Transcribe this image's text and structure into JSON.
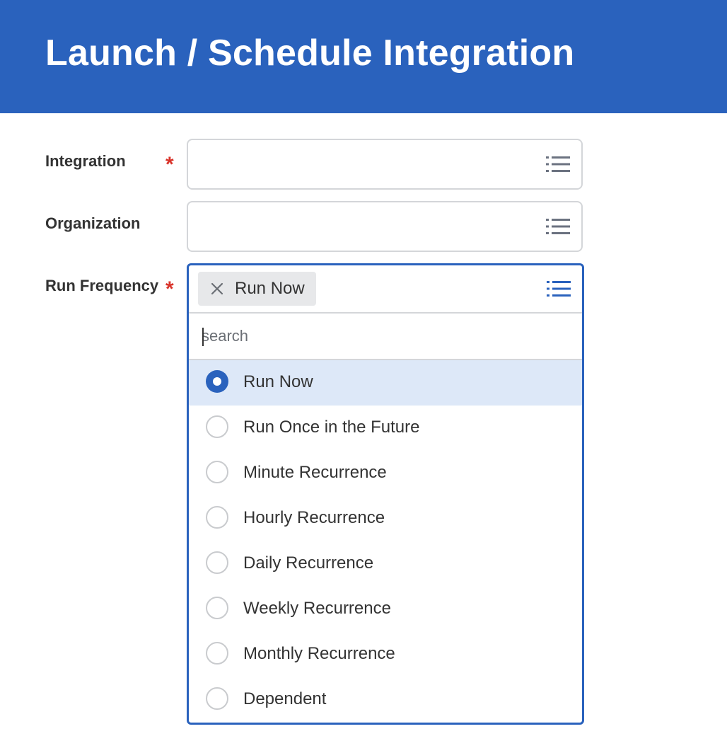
{
  "header": {
    "title": "Launch / Schedule Integration",
    "background_color": "#2a62bd"
  },
  "form": {
    "integration": {
      "label": "Integration",
      "required_marker": "*",
      "value": "",
      "icon": "list-icon"
    },
    "organization": {
      "label": "Organization",
      "value": "",
      "icon": "list-icon"
    },
    "run_frequency": {
      "label": "Run Frequency",
      "required_marker": "*",
      "selected_pill": "Run Now",
      "remove_icon": "close-icon",
      "icon": "list-icon",
      "search_placeholder": "search",
      "options": [
        {
          "label": "Run Now",
          "selected": true
        },
        {
          "label": "Run Once in the Future",
          "selected": false
        },
        {
          "label": "Minute Recurrence",
          "selected": false
        },
        {
          "label": "Hourly Recurrence",
          "selected": false
        },
        {
          "label": "Daily Recurrence",
          "selected": false
        },
        {
          "label": "Weekly Recurrence",
          "selected": false
        },
        {
          "label": "Monthly Recurrence",
          "selected": false
        },
        {
          "label": "Dependent",
          "selected": false
        }
      ]
    }
  },
  "colors": {
    "accent": "#2a62bd",
    "required": "#d9342b",
    "selected_row": "#dde8f8",
    "border": "#d4d6d9",
    "pill": "#e7e8ea"
  }
}
